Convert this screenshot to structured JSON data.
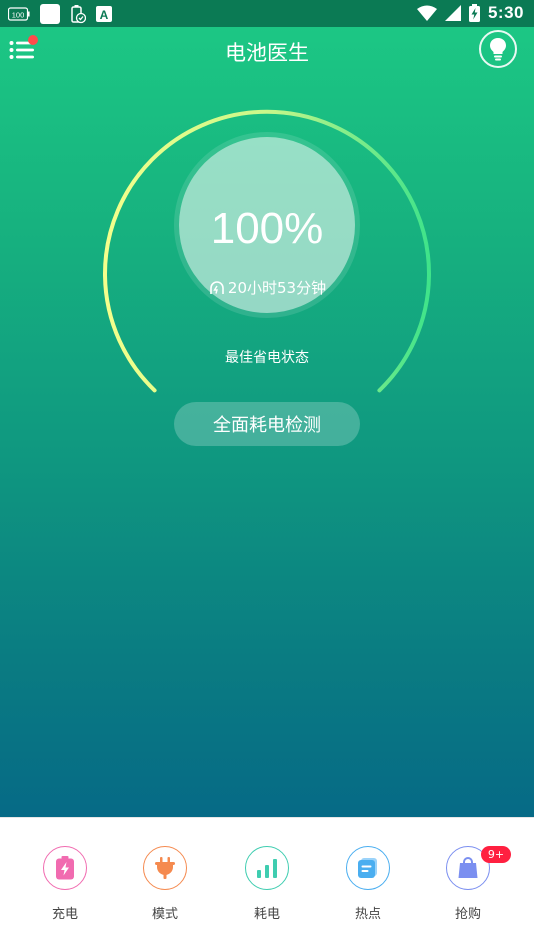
{
  "status_bar": {
    "time": "5:30",
    "left_icons": [
      "battery-100-icon",
      "app-square-icon",
      "battery-check-icon",
      "a-letter-icon"
    ],
    "battery_icon_label": "100"
  },
  "header": {
    "title": "电池医生",
    "menu_icon": "menu-list-icon",
    "has_notification_dot": true,
    "tip_icon": "light-bulb-icon"
  },
  "battery": {
    "percent_label": "100%",
    "percent_value": 100,
    "remaining_time": "20小时53分钟",
    "status": "最佳省电状态"
  },
  "actions": {
    "full_check_label": "全面耗电检测"
  },
  "bottom_nav": {
    "items": [
      {
        "label": "充电",
        "icon": "charging-icon",
        "color": "#f16bb0"
      },
      {
        "label": "模式",
        "icon": "plug-icon",
        "color": "#f58a4f"
      },
      {
        "label": "耗电",
        "icon": "bar-chart-icon",
        "color": "#3fcdb0"
      },
      {
        "label": "热点",
        "icon": "news-icon",
        "color": "#4aaef0"
      },
      {
        "label": "抢购",
        "icon": "shopping-bag-icon",
        "color": "#7b8ff0",
        "badge": "9+"
      }
    ]
  },
  "colors": {
    "gradient_top": "#1cc784",
    "gradient_bottom": "#066a86",
    "arc_yellow": "#f0ff8a",
    "arc_green": "#3fe38a",
    "badge": "#ff2040"
  }
}
